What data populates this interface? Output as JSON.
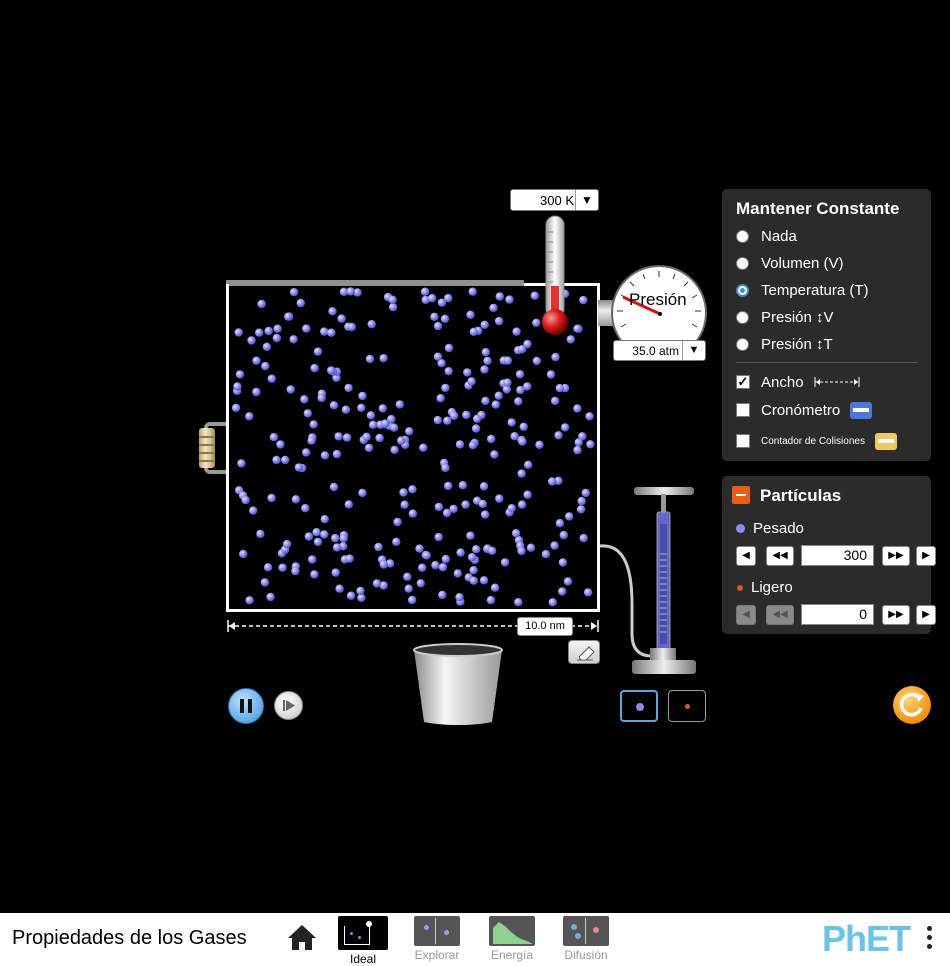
{
  "temperature": {
    "value": "300 K",
    "dropdown_icon": "triangle-down"
  },
  "pressure": {
    "gauge_label": "Presión",
    "value": "35.0 atm",
    "dropdown_icon": "triangle-down"
  },
  "container": {
    "width_value": "10.0 nm"
  },
  "constant_panel": {
    "title": "Mantener Constante",
    "options": [
      {
        "label": "Nada",
        "selected": false
      },
      {
        "label": "Volumen (V)",
        "selected": false
      },
      {
        "label": "Temperatura (T)",
        "selected": true
      },
      {
        "label": "Presión ↕V",
        "selected": false
      },
      {
        "label": "Presión ↕T",
        "selected": false
      }
    ],
    "checks": [
      {
        "label": "Ancho",
        "checked": true
      },
      {
        "label": "Cronómetro",
        "checked": false
      },
      {
        "label": "Contador de Colisiones",
        "checked": false
      }
    ]
  },
  "particles_panel": {
    "title": "Partículas",
    "heavy": {
      "label": "Pesado",
      "count": "300",
      "color": "#8c8cf5"
    },
    "light": {
      "label": "Ligero",
      "count": "0",
      "color": "#e8502a"
    }
  },
  "colors": {
    "accent": "#3f8fd0",
    "reset": "#f39a1a",
    "panel": "#2b2b2b",
    "heavy_particle": "#8c8cf5"
  },
  "navbar": {
    "title": "Propiedades de los Gases",
    "home_icon": "home-icon",
    "screens": [
      {
        "label": "Ideal",
        "active": true
      },
      {
        "label": "Explorar",
        "active": false
      },
      {
        "label": "Energía",
        "active": false
      },
      {
        "label": "Difusión",
        "active": false
      }
    ],
    "logo": "PhET"
  }
}
